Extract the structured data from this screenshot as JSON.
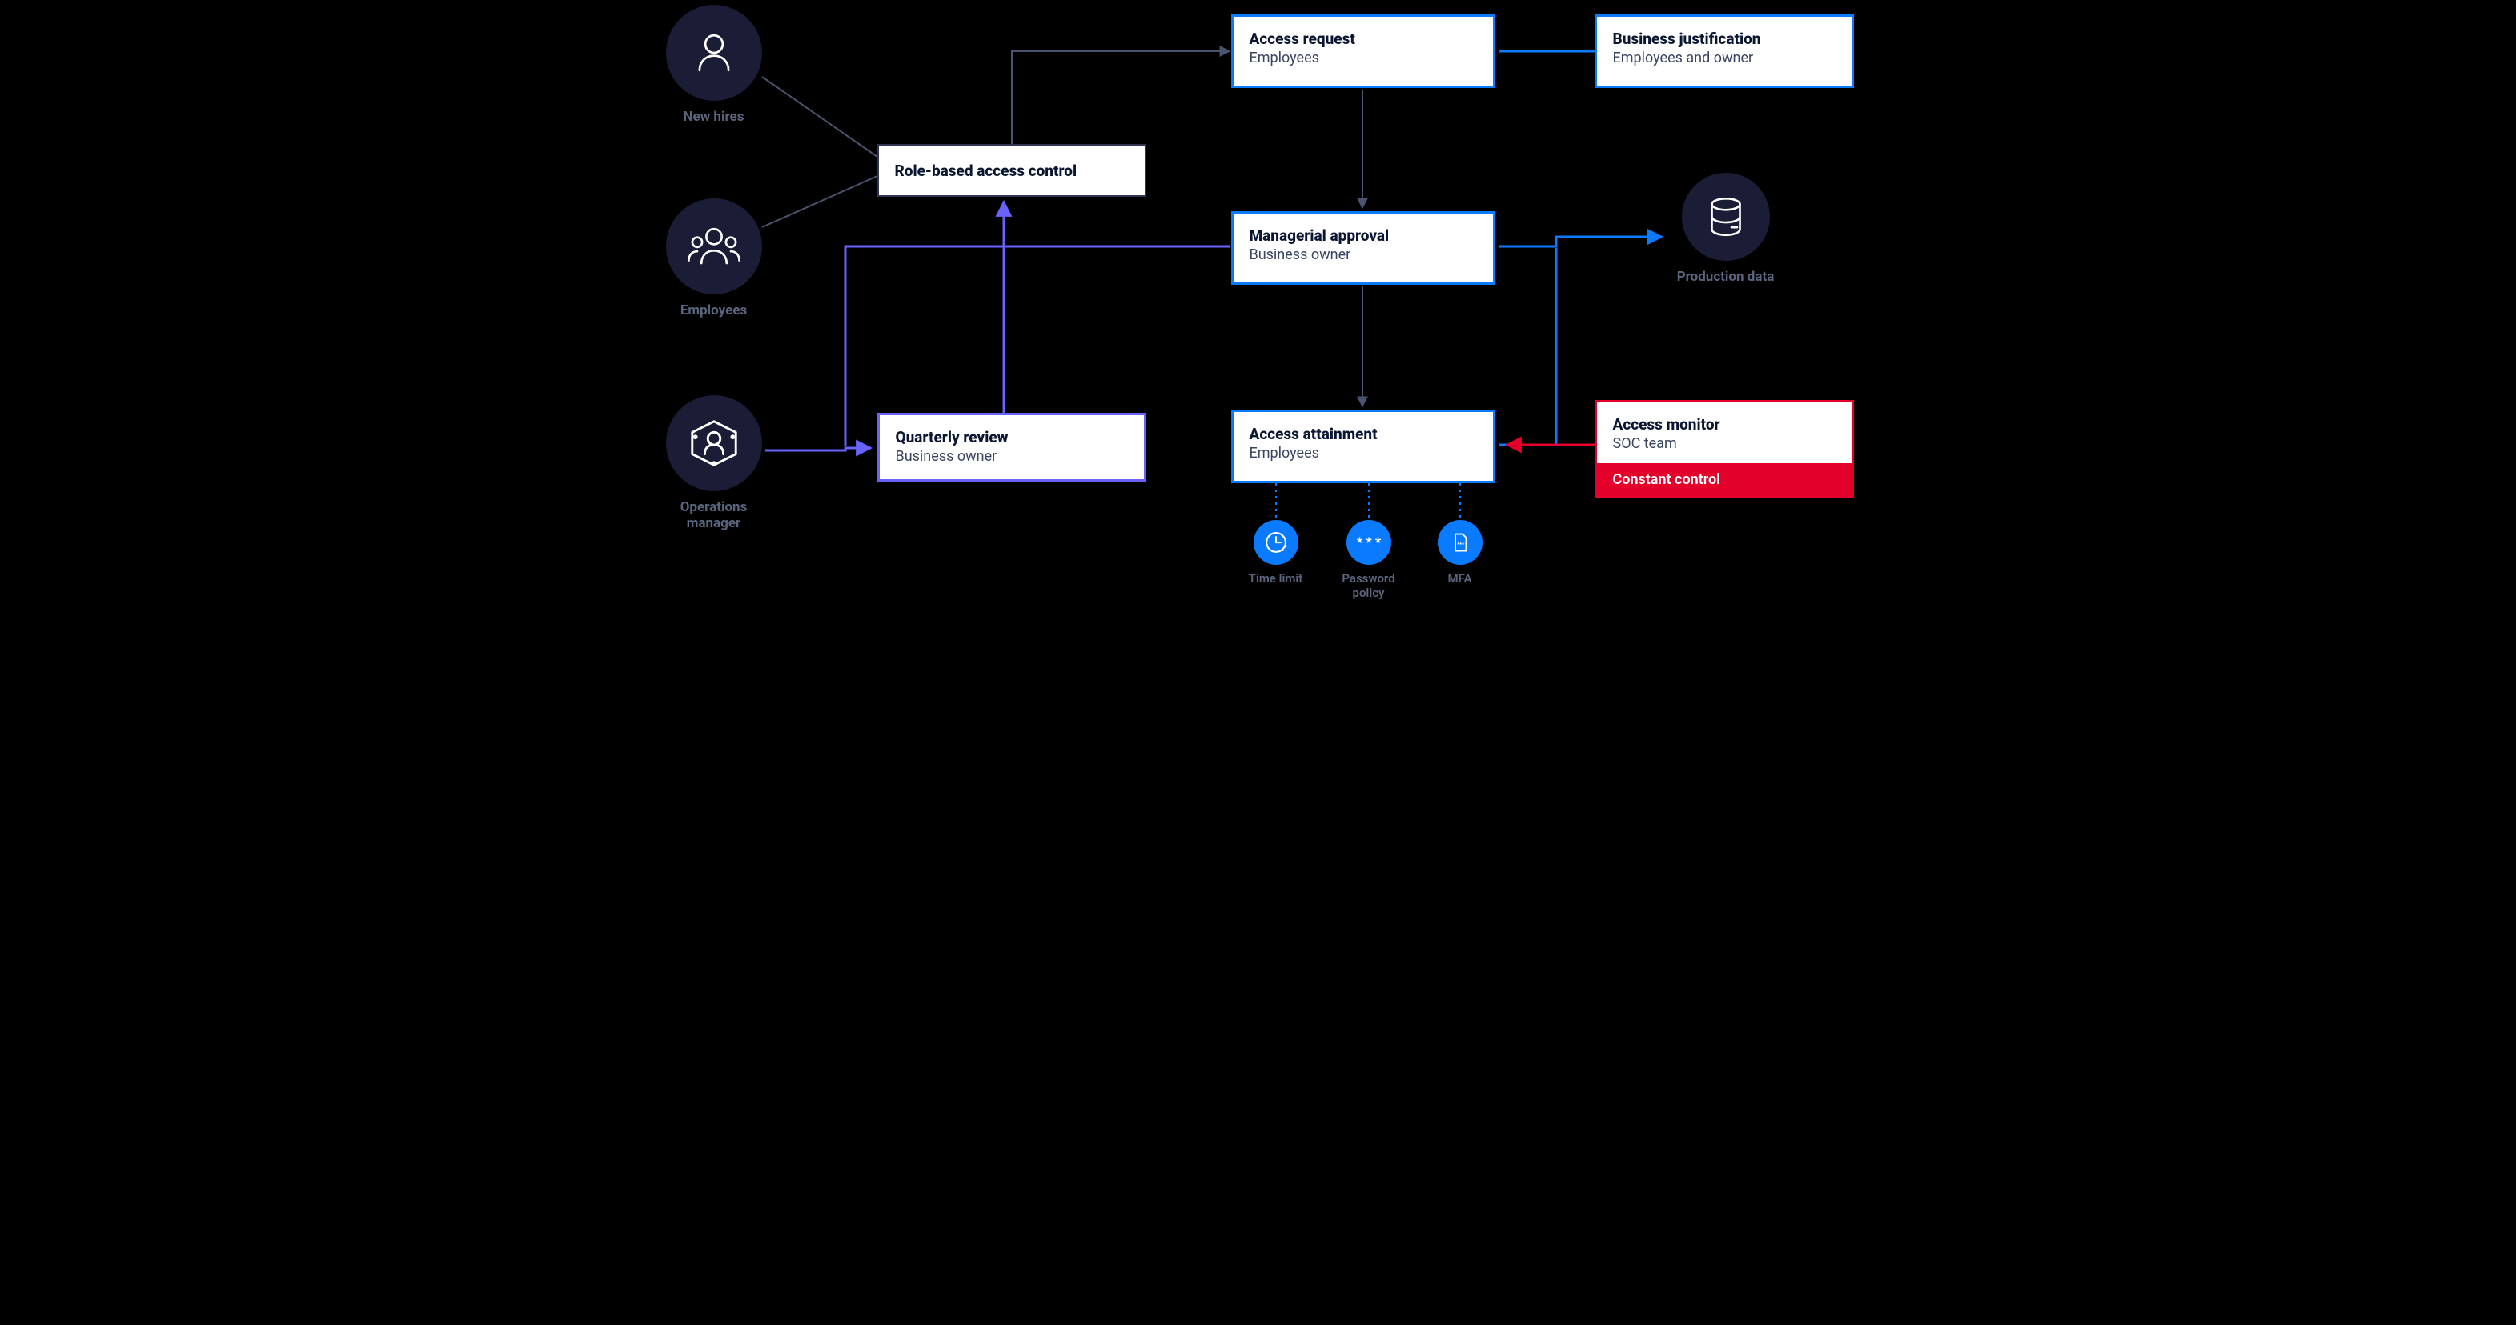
{
  "actors": {
    "new_hires": "New hires",
    "employees": "Employees",
    "ops_mgr_l1": "Operations",
    "ops_mgr_l2": "manager",
    "prod_data": "Production data"
  },
  "boxes": {
    "rbac": "Role-based access control",
    "access_request": {
      "t": "Access request",
      "s": "Employees"
    },
    "biz_just": {
      "t": "Business justification",
      "s": "Employees and owner"
    },
    "mgr_approval": {
      "t": "Managerial approval",
      "s": "Business owner"
    },
    "quarterly": {
      "t": "Quarterly review",
      "s": "Business owner"
    },
    "attainment": {
      "t": "Access attainment",
      "s": "Employees"
    },
    "monitor": {
      "t": "Access monitor",
      "s": "SOC team",
      "bar": "Constant control"
    }
  },
  "controls": {
    "time": "Time limit",
    "pwd_l1": "Password",
    "pwd_l2": "policy",
    "mfa": "MFA"
  }
}
